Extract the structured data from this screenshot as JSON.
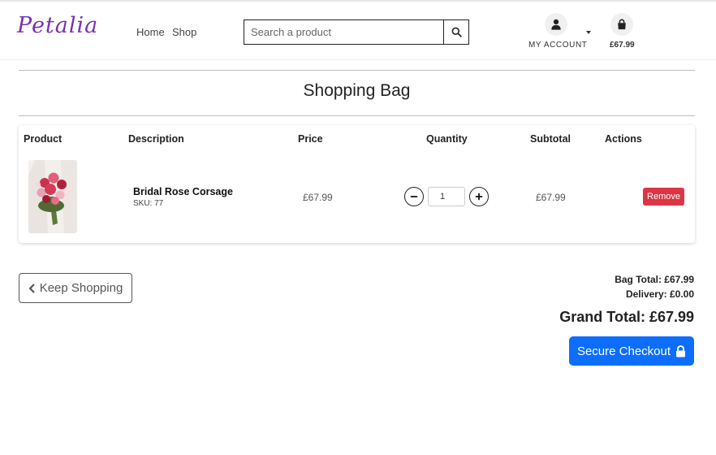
{
  "brand": {
    "logo": "Petalia",
    "accent": "#7b2fb0"
  },
  "nav": {
    "home": "Home",
    "shop": "Shop"
  },
  "search": {
    "placeholder": "Search a product",
    "value": ""
  },
  "header": {
    "account_label": "MY ACCOUNT",
    "bag_total": "£67.99"
  },
  "page": {
    "title": "Shopping Bag"
  },
  "table": {
    "columns": [
      "Product",
      "Description",
      "Price",
      "Quantity",
      "Subtotal",
      "Actions"
    ],
    "rows": [
      {
        "name": "Bridal Rose Corsage",
        "sku": "SKU: 77",
        "price": "£67.99",
        "quantity": "1",
        "subtotal": "£67.99",
        "action": "Remove"
      }
    ]
  },
  "actions": {
    "keep_shopping": "Keep Shopping",
    "checkout": "Secure Checkout"
  },
  "summary": {
    "bag_total": "Bag Total: £67.99",
    "delivery": "Delivery: £0.00",
    "grand_total": "Grand Total: £67.99"
  },
  "colors": {
    "remove": "#dc3545",
    "checkout": "#0d6efd"
  }
}
